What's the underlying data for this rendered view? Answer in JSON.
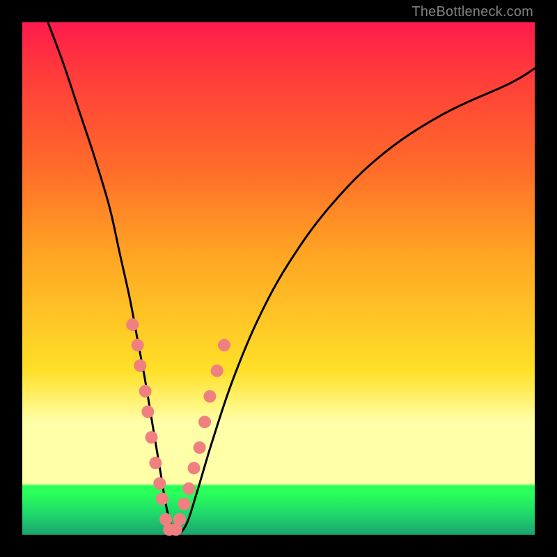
{
  "watermark": "TheBottleneck.com",
  "colors": {
    "curve_stroke": "#000000",
    "dot_fill": "#f08080",
    "plot_frame": "#000000"
  },
  "chart_data": {
    "type": "line",
    "title": "",
    "xlabel": "",
    "ylabel": "",
    "xlim": [
      0,
      100
    ],
    "ylim": [
      0,
      100
    ],
    "series": [
      {
        "name": "bottleneck-curve",
        "x": [
          5,
          8,
          11,
          14,
          17,
          19,
          21,
          22.5,
          24,
          25.5,
          27,
          28,
          29,
          30,
          32,
          34,
          37,
          41,
          46,
          52,
          60,
          70,
          82,
          95,
          100
        ],
        "values": [
          100,
          92,
          83,
          74,
          64,
          55,
          46,
          38,
          30,
          21,
          12,
          6,
          2,
          0,
          2,
          8,
          18,
          30,
          42,
          53,
          64,
          74,
          82,
          88,
          91
        ]
      },
      {
        "name": "dots-left-branch",
        "type": "scatter",
        "x": [
          21.5,
          22.5,
          23.0,
          24.0,
          24.5,
          25.2,
          26.0,
          26.8,
          27.3,
          28.0,
          28.7
        ],
        "values": [
          41,
          37,
          33,
          28,
          24,
          19,
          14,
          10,
          7,
          3,
          1
        ]
      },
      {
        "name": "dots-right-branch",
        "type": "scatter",
        "x": [
          30.0,
          30.7,
          31.6,
          32.5,
          33.5,
          34.6,
          35.6,
          36.6,
          38.0,
          39.4
        ],
        "values": [
          1,
          3,
          6,
          9,
          13,
          17,
          22,
          27,
          32,
          37
        ]
      }
    ],
    "gradient_bands_rgb_top_to_bottom": [
      "#ff1a4d",
      "#ff6a2a",
      "#ffe028",
      "#ffffa8",
      "#2aff5a",
      "#1aa36e"
    ]
  }
}
